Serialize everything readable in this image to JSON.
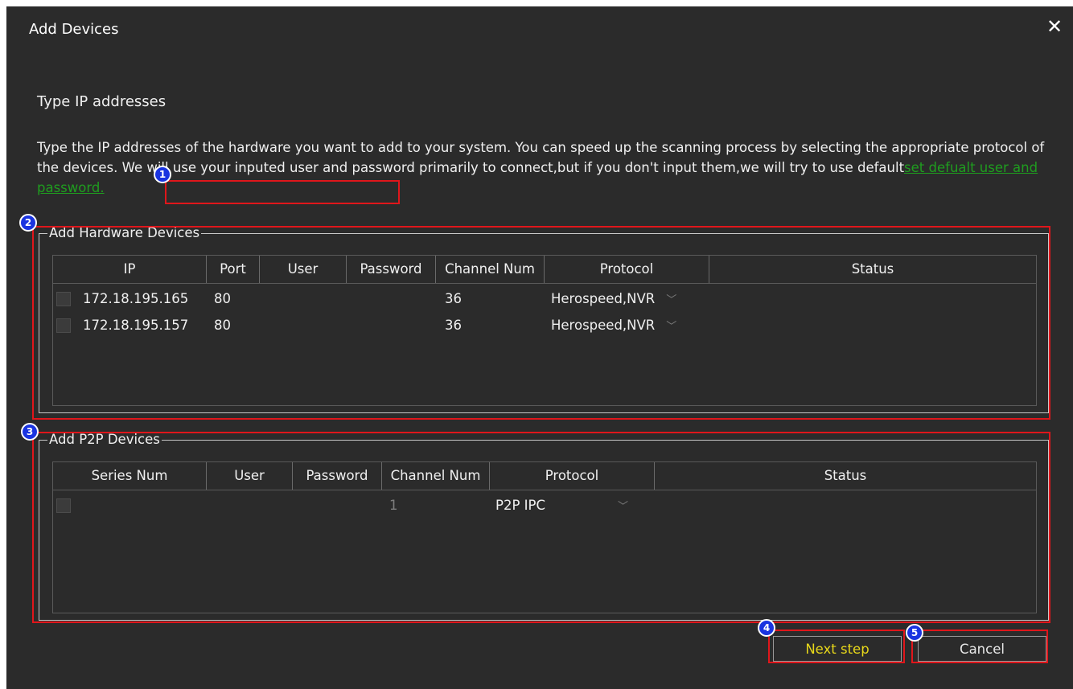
{
  "dialog": {
    "title": "Add Devices",
    "close_icon": "close-icon",
    "heading": "Type IP addresses",
    "description": "Type the IP addresses of the hardware you want to add to your system. You can speed up the scanning process by selecting the appropriate protocol of the devices. We will use your inputed user and password primarily to connect,but if you don't input them,we will try to use default",
    "link_text": "set defualt user and password."
  },
  "hardware": {
    "legend": "Add Hardware Devices",
    "columns": [
      "IP",
      "Port",
      "User",
      "Password",
      "Channel Num",
      "Protocol",
      "Status"
    ],
    "rows": [
      {
        "ip": "172.18.195.165",
        "port": "80",
        "user": "",
        "password": "",
        "channel": "36",
        "protocol": "Herospeed,NVR",
        "status": ""
      },
      {
        "ip": "172.18.195.157",
        "port": "80",
        "user": "",
        "password": "",
        "channel": "36",
        "protocol": "Herospeed,NVR",
        "status": ""
      }
    ]
  },
  "p2p": {
    "legend": "Add P2P Devices",
    "columns": [
      "Series Num",
      "User",
      "Password",
      "Channel Num",
      "Protocol",
      "Status"
    ],
    "rows": [
      {
        "series": "",
        "user": "",
        "password": "",
        "channel": "1",
        "protocol": "P2P IPC",
        "status": ""
      }
    ]
  },
  "buttons": {
    "next": "Next step",
    "cancel": "Cancel"
  },
  "markers": [
    "1",
    "2",
    "3",
    "4",
    "5"
  ],
  "colors": {
    "background": "#2b2b2b",
    "link": "#1f9e1f",
    "next_text": "#e8d81a",
    "highlight": "#e0161b",
    "marker": "#1a34e0"
  }
}
